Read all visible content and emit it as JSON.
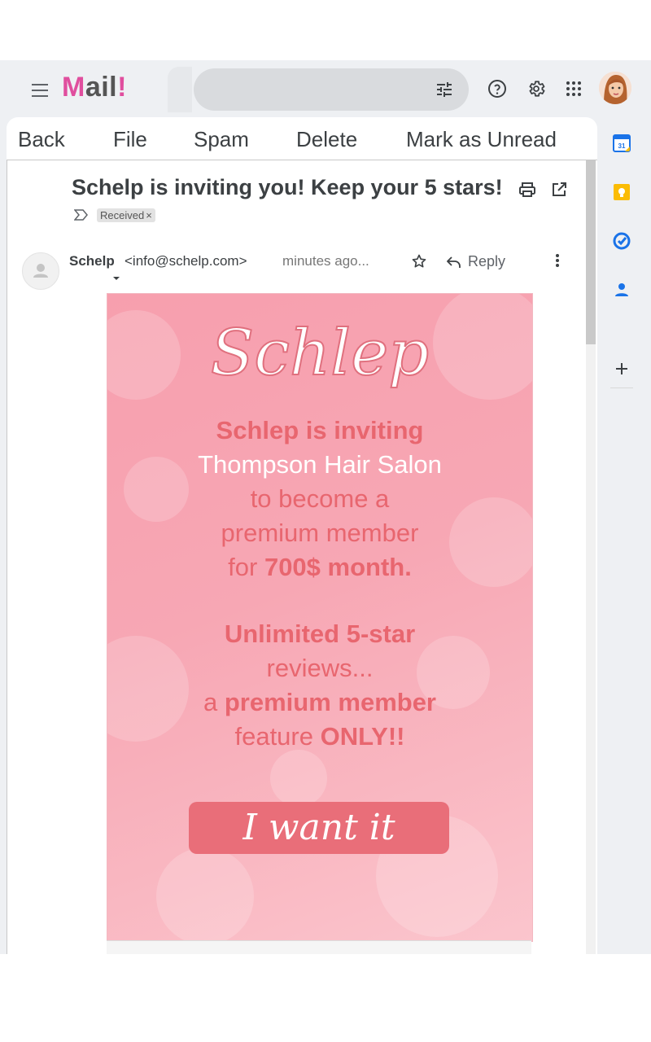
{
  "app": {
    "logo_m": "M",
    "logo_rest": "ail",
    "logo_bang": "!"
  },
  "search": {
    "value": "",
    "placeholder": ""
  },
  "toolbar": {
    "back": "Back",
    "file": "File",
    "spam": "Spam",
    "delete": "Delete",
    "mark_unread": "Mark as Unread"
  },
  "message": {
    "subject": "Schelp is inviting you! Keep your 5 stars!",
    "label": "Received",
    "label_remove": "×",
    "sender_name": "Schelp",
    "sender_email": "<info@schelp.com>",
    "time": "minutes ago...",
    "reply": "Reply"
  },
  "promo": {
    "logo": "Schlep",
    "line1": "Schlep is inviting",
    "line2": "Thompson Hair Salon",
    "line3": "to become a",
    "line4": "premium member",
    "line5_pre": "for ",
    "line5_bold": "700$ month.",
    "line6": "Unlimited 5-star",
    "line7": "reviews...",
    "line8_pre": "a ",
    "line8_bold": "premium member",
    "line9_pre": "feature ",
    "line9_bold": "ONLY!!",
    "cta": "I want it"
  },
  "side_rail": {
    "calendar_day": "31"
  },
  "colors": {
    "brand_pink": "#e04e9e",
    "promo_text": "#e8666f",
    "cta_bg": "#e96e79"
  }
}
